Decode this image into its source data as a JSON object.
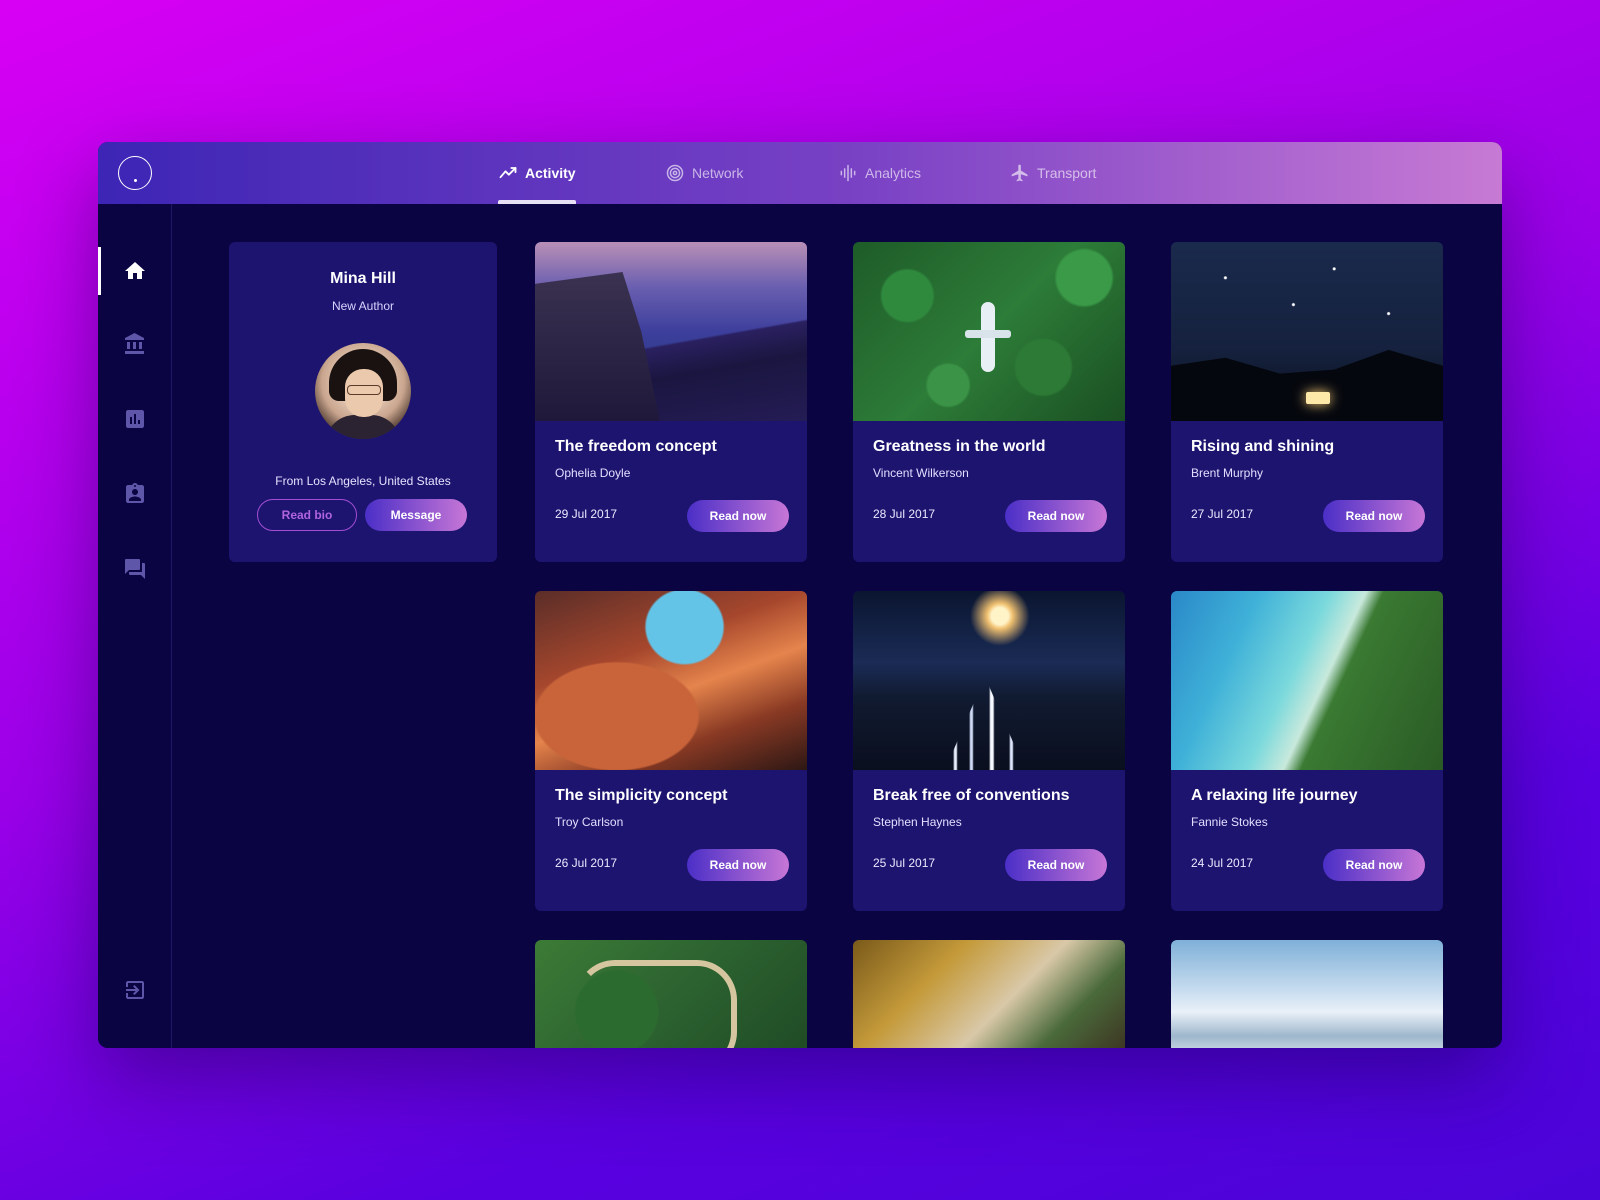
{
  "nav": {
    "tabs": [
      {
        "label": "Activity",
        "icon": "activity-icon",
        "active": true
      },
      {
        "label": "Network",
        "icon": "network-icon",
        "active": false
      },
      {
        "label": "Analytics",
        "icon": "analytics-icon",
        "active": false
      },
      {
        "label": "Transport",
        "icon": "airplane-icon",
        "active": false
      }
    ]
  },
  "sidebar": {
    "items": [
      {
        "icon": "home-icon",
        "active": true
      },
      {
        "icon": "bank-icon",
        "active": false
      },
      {
        "icon": "chart-icon",
        "active": false
      },
      {
        "icon": "contact-icon",
        "active": false
      },
      {
        "icon": "chat-icon",
        "active": false
      }
    ],
    "logout_icon": "logout-icon"
  },
  "profile": {
    "name": "Mina Hill",
    "role": "New Author",
    "location": "From Los Angeles, United States",
    "read_bio": "Read bio",
    "message": "Message"
  },
  "posts": [
    {
      "title": "The freedom concept",
      "author": "Ophelia Doyle",
      "date": "29 Jul 2017",
      "cta": "Read now"
    },
    {
      "title": "Greatness in the world",
      "author": "Vincent Wilkerson",
      "date": "28 Jul 2017",
      "cta": "Read now"
    },
    {
      "title": "Rising and shining",
      "author": "Brent Murphy",
      "date": "27 Jul 2017",
      "cta": "Read now"
    },
    {
      "title": "The simplicity concept",
      "author": "Troy Carlson",
      "date": "26 Jul 2017",
      "cta": "Read now"
    },
    {
      "title": "Break free of conventions",
      "author": "Stephen Haynes",
      "date": "25 Jul 2017",
      "cta": "Read now"
    },
    {
      "title": "A relaxing life journey",
      "author": "Fannie Stokes",
      "date": "24 Jul 2017",
      "cta": "Read now"
    }
  ],
  "colors": {
    "background_start": "#d800f4",
    "background_end": "#4a04d8",
    "window_bg": "#0a0442",
    "card_bg": "#1d1470",
    "accent_start": "#4b2fc7",
    "accent_end": "#c776d6"
  }
}
